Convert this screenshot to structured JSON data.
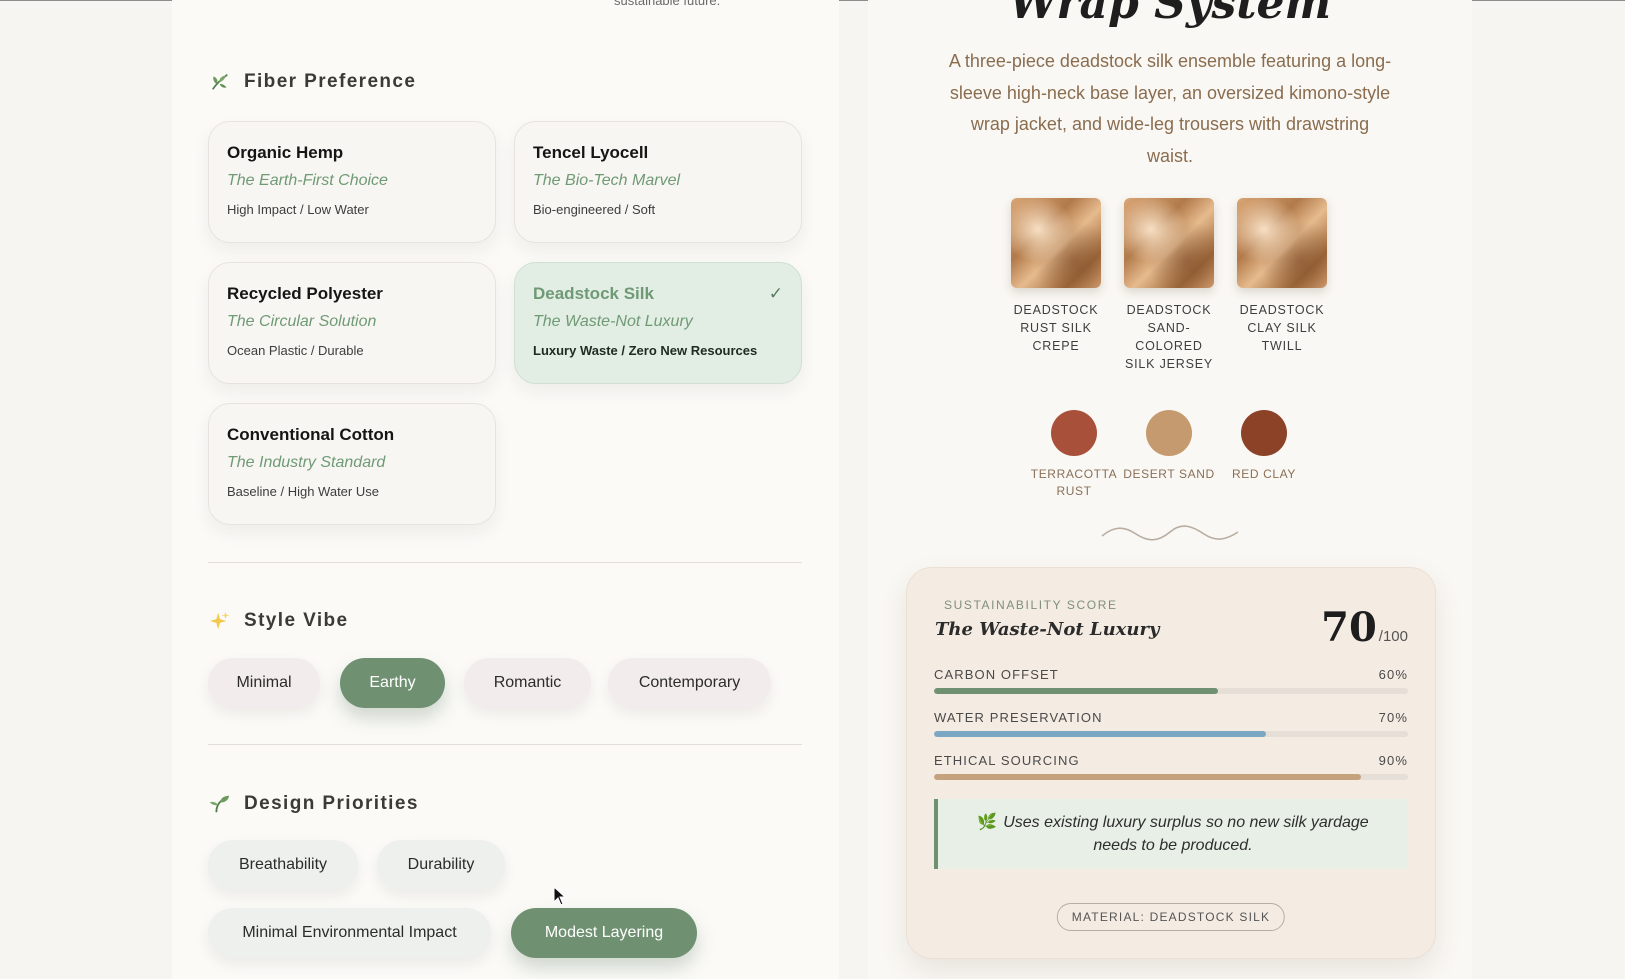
{
  "left": {
    "cut_text": "sustainable future.",
    "fiber_section": {
      "title": "Fiber Preference",
      "icon": "leaf-icon",
      "cards": [
        {
          "name": "Organic Hemp",
          "tagline": "The Earth-First Choice",
          "meta": "High Impact / Low Water",
          "selected": false
        },
        {
          "name": "Tencel Lyocell",
          "tagline": "The Bio-Tech Marvel",
          "meta": "Bio-engineered / Soft",
          "selected": false
        },
        {
          "name": "Recycled Polyester",
          "tagline": "The Circular Solution",
          "meta": "Ocean Plastic / Durable",
          "selected": false
        },
        {
          "name": "Deadstock Silk",
          "tagline": "The Waste-Not Luxury",
          "meta": "Luxury Waste / Zero New Resources",
          "selected": true,
          "check": "✓"
        },
        {
          "name": "Conventional Cotton",
          "tagline": "The Industry Standard",
          "meta": "Baseline / High Water Use",
          "selected": false
        }
      ]
    },
    "style_section": {
      "title": "Style Vibe",
      "icon": "sparkles-icon",
      "options": [
        {
          "label": "Minimal",
          "active": false
        },
        {
          "label": "Earthy",
          "active": true
        },
        {
          "label": "Romantic",
          "active": false
        },
        {
          "label": "Contemporary",
          "active": false
        }
      ]
    },
    "priorities_section": {
      "title": "Design Priorities",
      "icon": "seedling-icon",
      "options": [
        {
          "label": "Breathability",
          "active": false
        },
        {
          "label": "Durability",
          "active": false
        },
        {
          "label": "Minimal Environmental Impact",
          "active": false
        },
        {
          "label": "Modest Layering",
          "active": true
        }
      ]
    }
  },
  "right": {
    "title_cut": "Wrap System",
    "description": "A three-piece deadstock silk ensemble featuring a long-sleeve high-neck base layer, an oversized kimono-style wrap jacket, and wide-leg trousers with drawstring waist.",
    "fabrics": [
      {
        "label": "DEADSTOCK RUST SILK CREPE"
      },
      {
        "label": "DEADSTOCK SAND-COLORED SILK JERSEY"
      },
      {
        "label": "DEADSTOCK CLAY SILK TWILL"
      }
    ],
    "palette": [
      {
        "label": "TERRACOTTA RUST",
        "color": "#a9503a"
      },
      {
        "label": "DESERT SAND",
        "color": "#c59a6e"
      },
      {
        "label": "RED CLAY",
        "color": "#8c4226"
      }
    ],
    "score": {
      "eyebrow": "SUSTAINABILITY SCORE",
      "name": "The Waste-Not Luxury",
      "value": "70",
      "denominator": "/100",
      "metrics": [
        {
          "label": "CARBON OFFSET",
          "value": "60%",
          "fraction": 0.6,
          "color": "#6f9172"
        },
        {
          "label": "WATER PRESERVATION",
          "value": "70%",
          "fraction": 0.7,
          "color": "#7aa8c2"
        },
        {
          "label": "ETHICAL SOURCING",
          "value": "90%",
          "fraction": 0.9,
          "color": "#c5a27e"
        }
      ],
      "note": "Uses existing luxury surplus so no new silk yardage needs to be produced.",
      "material_chip": "MATERIAL: DEADSTOCK SILK"
    }
  },
  "colors": {
    "accent_green": "#6f9172",
    "selected_card_bg": "#e2ede4"
  }
}
